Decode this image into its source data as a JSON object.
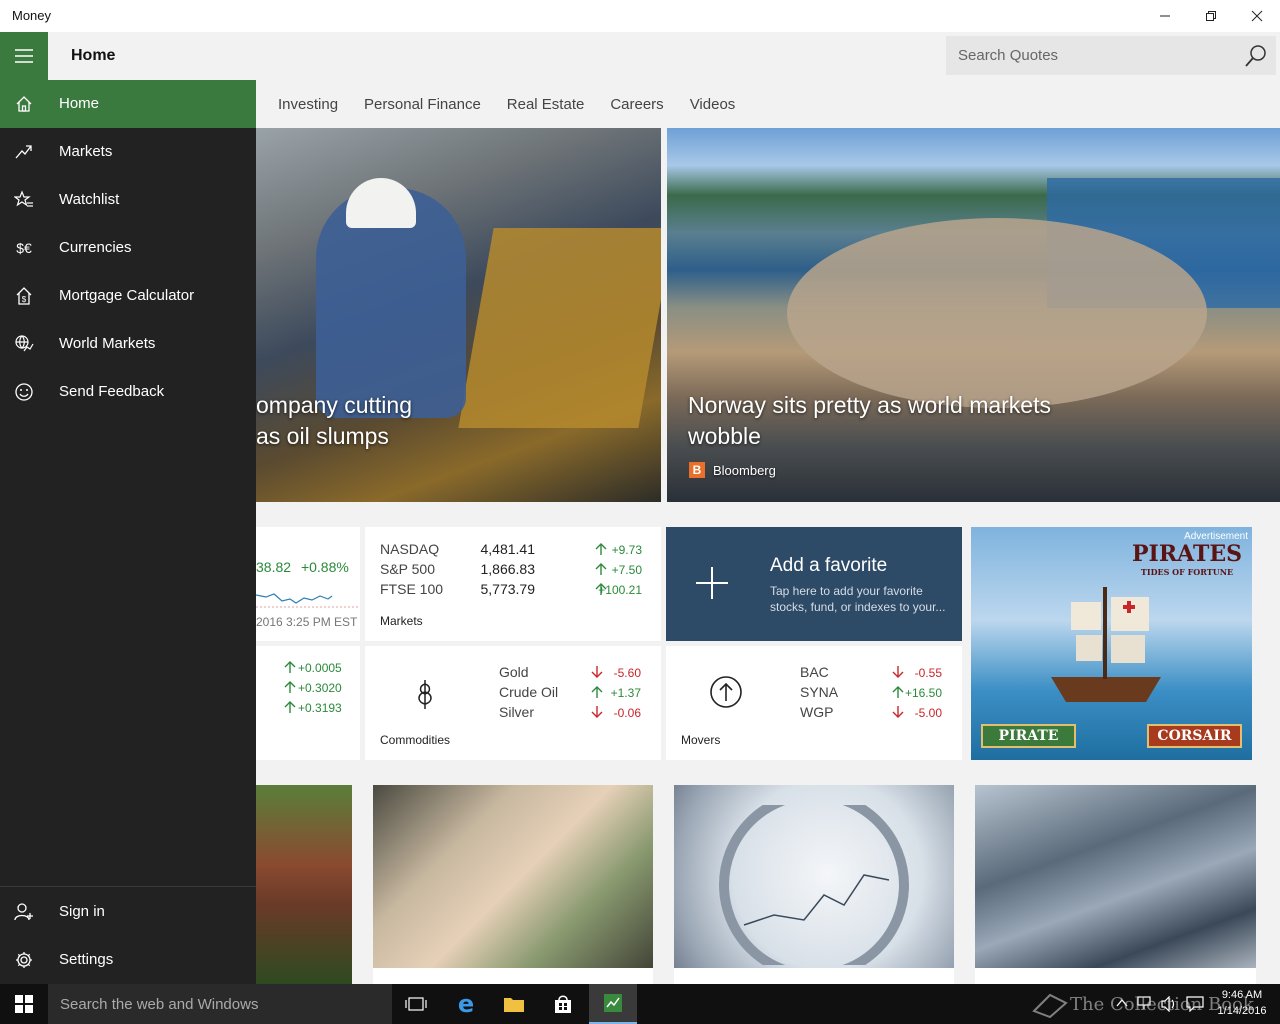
{
  "window": {
    "app_title": "Money"
  },
  "header": {
    "page_title": "Home",
    "search_placeholder": "Search Quotes"
  },
  "tabs": [
    "Investing",
    "Personal Finance",
    "Real Estate",
    "Careers",
    "Videos"
  ],
  "hero": [
    {
      "headline_line1": "ompany cutting",
      "headline_line2": "as oil slumps"
    },
    {
      "headline": "Norway sits pretty as world markets wobble",
      "source": "Bloomberg"
    }
  ],
  "tiles": {
    "left_partial": {
      "price": "38.82",
      "change": "+0.88%",
      "date": "2016 3:25 PM EST"
    },
    "markets": {
      "label": "Markets",
      "rows": [
        {
          "name": "NASDAQ",
          "value": "4,481.41",
          "change": "+9.73",
          "dir": "up"
        },
        {
          "name": "S&P 500",
          "value": "1,866.83",
          "change": "+7.50",
          "dir": "up"
        },
        {
          "name": "FTSE 100",
          "value": "5,773.79",
          "change": "+100.21",
          "dir": "up"
        }
      ]
    },
    "favorite": {
      "title": "Add a favorite",
      "desc": "Tap here to add your favorite stocks, fund, or indexes to your..."
    },
    "currencies_partial": {
      "changes": [
        "+0.0005",
        "+0.3020",
        "+0.3193"
      ]
    },
    "commodities": {
      "label": "Commodities",
      "rows": [
        {
          "name": "Gold",
          "change": "-5.60",
          "dir": "down"
        },
        {
          "name": "Crude Oil",
          "change": "+1.37",
          "dir": "up"
        },
        {
          "name": "Silver",
          "change": "-0.06",
          "dir": "down"
        }
      ]
    },
    "movers": {
      "label": "Movers",
      "rows": [
        {
          "name": "BAC",
          "change": "-0.55",
          "dir": "down"
        },
        {
          "name": "SYNA",
          "change": "+16.50",
          "dir": "up"
        },
        {
          "name": "WGP",
          "change": "-5.00",
          "dir": "down"
        }
      ]
    },
    "ad": {
      "label": "Advertisement",
      "title": "PIRATES",
      "subtitle": "TIDES OF FORTUNE",
      "btn_left": "PIRATE",
      "btn_right": "CORSAIR"
    }
  },
  "sidebar": {
    "items": [
      {
        "label": "Home",
        "icon": "home-icon"
      },
      {
        "label": "Markets",
        "icon": "trend-icon"
      },
      {
        "label": "Watchlist",
        "icon": "star-list-icon"
      },
      {
        "label": "Currencies",
        "icon": "currency-icon"
      },
      {
        "label": "Mortgage Calculator",
        "icon": "house-dollar-icon"
      },
      {
        "label": "World Markets",
        "icon": "globe-chart-icon"
      },
      {
        "label": "Send Feedback",
        "icon": "smiley-icon"
      }
    ],
    "footer": [
      {
        "label": "Sign in",
        "icon": "add-user-icon"
      },
      {
        "label": "Settings",
        "icon": "gear-icon"
      }
    ]
  },
  "taskbar": {
    "search_placeholder": "Search the web and Windows",
    "time": "9:46 AM",
    "date": "1/14/2016",
    "watermark": "The Collection Book"
  },
  "colors": {
    "accent": "#3a7a3e",
    "sidebar": "#222222",
    "up": "#2a8a3a",
    "down": "#c8262a",
    "favorite_tile": "#2d4a66"
  }
}
